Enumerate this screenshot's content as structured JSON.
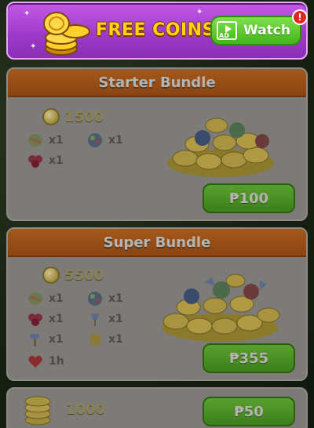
{
  "banner": {
    "title": "FREE COINS",
    "watch_label": "Watch",
    "ad_badge": "AD",
    "notification": "!"
  },
  "bundles": [
    {
      "title": "Starter Bundle",
      "coins": "1500",
      "items": [
        {
          "icon": "striped-candy-icon",
          "qty": "x1"
        },
        {
          "icon": "color-bomb-icon",
          "qty": "x1"
        },
        {
          "icon": "berry-cluster-icon",
          "qty": "x1"
        }
      ],
      "price": "₱100"
    },
    {
      "title": "Super Bundle",
      "coins": "5500",
      "items": [
        {
          "icon": "striped-candy-icon",
          "qty": "x1"
        },
        {
          "icon": "color-bomb-icon",
          "qty": "x1"
        },
        {
          "icon": "berry-cluster-icon",
          "qty": "x1"
        },
        {
          "icon": "shovel-booster-icon",
          "qty": "x1"
        },
        {
          "icon": "hammer-booster-icon",
          "qty": "x1"
        },
        {
          "icon": "glove-booster-icon",
          "qty": "x1"
        },
        {
          "icon": "heart-timer-icon",
          "qty": "1h"
        }
      ],
      "price": "₱355"
    },
    {
      "coins": "1000",
      "price": "₱50"
    }
  ],
  "colors": {
    "banner_purple": "#9c38c9",
    "coin_gold": "#ffd21a",
    "button_green": "#44b51c",
    "header_orange": "#a4581b"
  }
}
